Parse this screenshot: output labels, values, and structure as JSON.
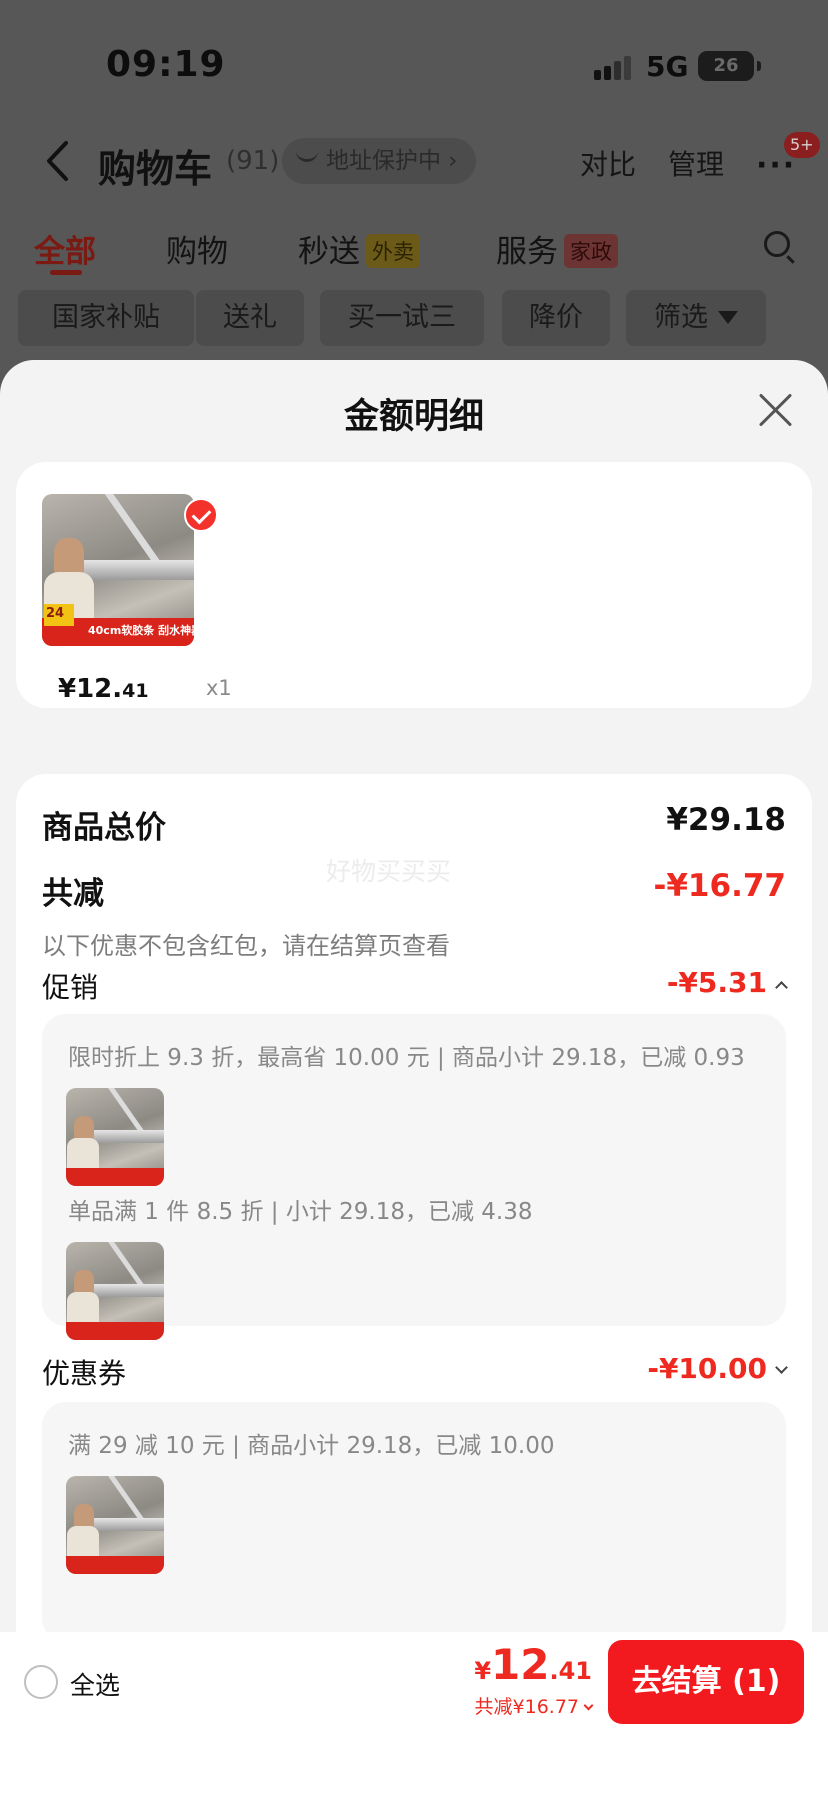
{
  "status": {
    "time": "09:19",
    "network": "5G",
    "battery": "26"
  },
  "header": {
    "title": "购物车",
    "count": "(91)",
    "address_pill": "地址保护中 ›",
    "compare_label": "对比",
    "manage_label": "管理",
    "more_badge": "5+"
  },
  "categories": [
    {
      "label": "全部",
      "tag": "",
      "active": true
    },
    {
      "label": "购物",
      "tag": ""
    },
    {
      "label": "秒送",
      "tag": "外卖"
    },
    {
      "label": "服务",
      "tag": "家政"
    }
  ],
  "chips": [
    "国家补贴",
    "送礼",
    "买一试三",
    "降价",
    "筛选"
  ],
  "sheet": {
    "title": "金额明细",
    "product": {
      "price_main": "¥12.",
      "price_dec": "41",
      "qty": "x1"
    },
    "summary": {
      "total_label": "商品总价",
      "total_value": "¥29.18",
      "watermark": "好物买买买",
      "discount_label": "共减",
      "discount_value": "-¥16.77",
      "note": "以下优惠不包含红包，请在结算页查看"
    },
    "promotion": {
      "label": "促销",
      "value": "-¥5.31",
      "line1": "限时折上 9.3 折，最高省 10.00 元 | 商品小计 29.18，已减 0.93",
      "line2": "单品满 1 件 8.5 折 | 小计 29.18，已减 4.38"
    },
    "coupon": {
      "label": "优惠券",
      "value": "-¥10.00",
      "line1": "满 29 减 10 元 | 商品小计 29.18，已减 10.00"
    }
  },
  "bottom": {
    "select_all": "全选",
    "total_currency": "¥",
    "total_int": "12",
    "total_dec": ".41",
    "saved": "共减¥16.77",
    "checkout": "去结算 (1)"
  },
  "colors": {
    "accent": "#ee2a20",
    "checkout_button": "#f31a1f",
    "sheet_bg": "#f3f3f3",
    "overlay": "#575757"
  }
}
